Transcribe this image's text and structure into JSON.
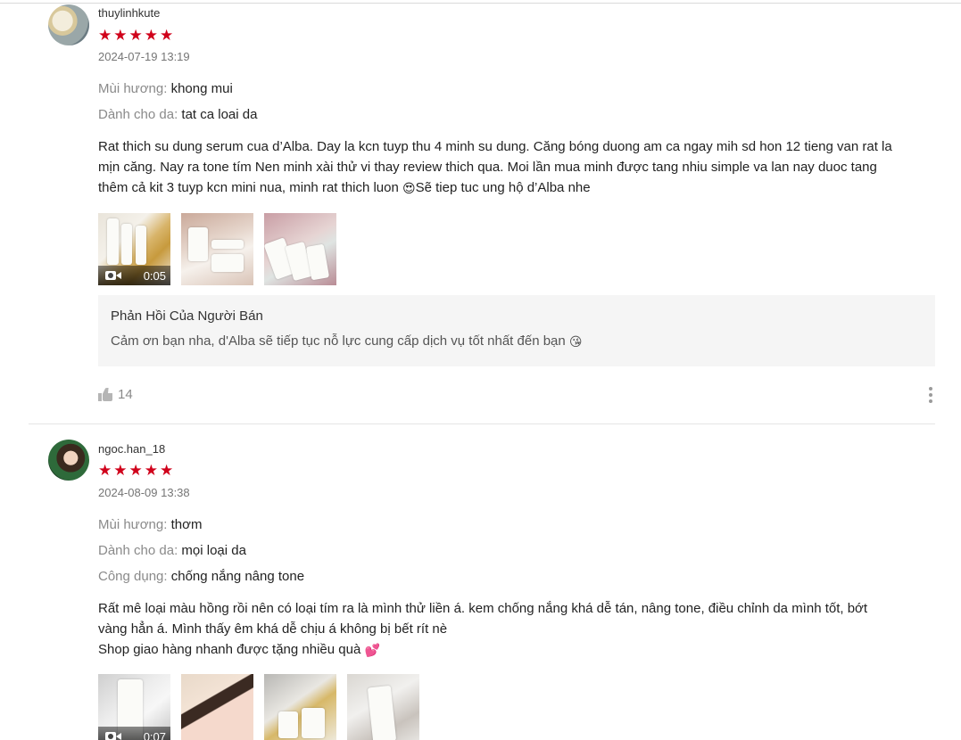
{
  "reviews": [
    {
      "username": "thuylinhkute",
      "stars": 5,
      "date": "2024-07-19 13:19",
      "attributes": [
        {
          "label": "Mùi hương:",
          "value": "khong mui"
        },
        {
          "label": "Dành cho da:",
          "value": "tat ca loai da"
        }
      ],
      "content_lines": [
        "Rat thich su dung serum cua d’Alba. Day la kcn tuyp thu 4 minh su dung. Căng bóng duong am ca ngay mih sd hon 12 tieng van rat la",
        "mịn căng. Nay ra tone tím Nen minh xài thử vi thay review thich qua. Moi lần mua minh được tang nhiu simple va lan nay duoc tang",
        "thêm cả kit 3 tuyp kcn mini nua, minh rat thich luon ",
        "Sẽ tiep tuc ung hộ d’Alba nhe"
      ],
      "content_emoji": "😍",
      "media": [
        {
          "type": "video",
          "duration": "0:05",
          "icon": "video-camera-icon"
        },
        {
          "type": "image"
        },
        {
          "type": "image"
        }
      ],
      "seller_reply": {
        "title": "Phản Hồi Của Người Bán",
        "text": "Cảm ơn bạn nha, d'Alba sẽ tiếp tục nỗ lực cung cấp dịch vụ tốt nhất đến bạn ",
        "emoji": "😘"
      },
      "likes": "14"
    },
    {
      "username": "ngoc.han_18",
      "stars": 5,
      "date": "2024-08-09 13:38",
      "attributes": [
        {
          "label": "Mùi hương:",
          "value": "thơm"
        },
        {
          "label": "Dành cho da:",
          "value": "mọi loại da"
        },
        {
          "label": "Công dụng:",
          "value": "chống nắng nâng tone"
        }
      ],
      "content_lines": [
        "Rất mê loại màu hồng rồi nên có loại tím ra là mình thử liền á. kem chống nắng khá dễ tán, nâng tone, điều chỉnh da mình tốt, bớt",
        "vàng hẳn á. Mình thấy êm khá dễ chịu á không bị bết rít nè",
        "Shop giao hàng nhanh được tặng nhiều quà "
      ],
      "content_emoji": "💕",
      "media": [
        {
          "type": "video",
          "duration": "0:07",
          "icon": "video-camera-icon"
        },
        {
          "type": "image"
        },
        {
          "type": "image"
        },
        {
          "type": "image"
        }
      ]
    }
  ],
  "icons": {
    "star": "star-icon",
    "like": "thumbs-up-icon",
    "more": "more-vertical-icon"
  },
  "colors": {
    "star": "#d0011b",
    "muted_label": "#8a8a8a",
    "reply_bg": "#f5f5f5"
  }
}
